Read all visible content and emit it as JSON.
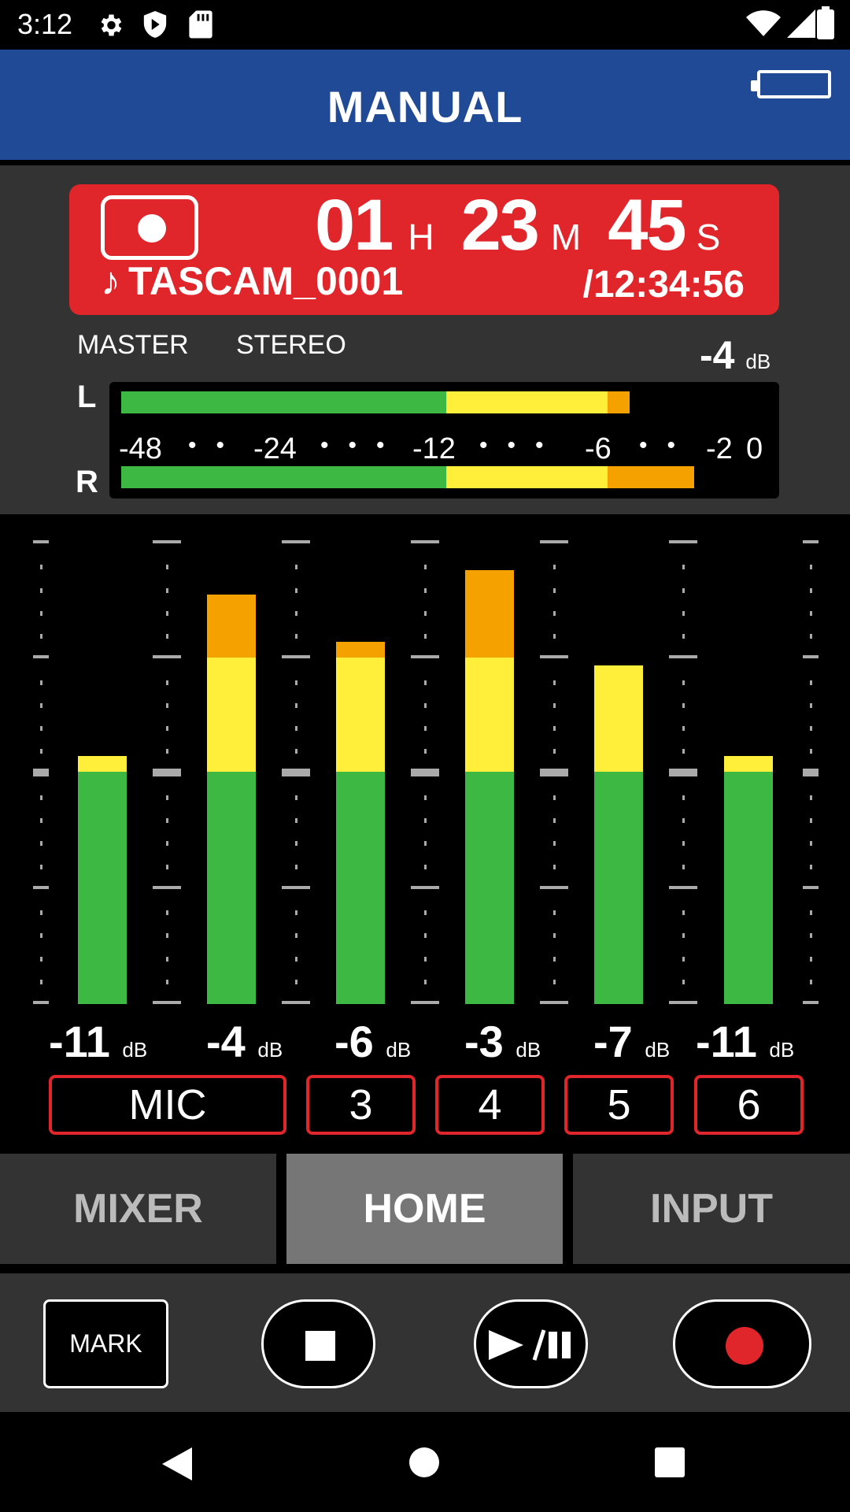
{
  "status_bar": {
    "time": "3:12"
  },
  "header": {
    "title": "MANUAL"
  },
  "recorder": {
    "hours": "01",
    "hours_unit": "H",
    "minutes": "23",
    "minutes_unit": "M",
    "seconds": "45",
    "seconds_unit": "S",
    "file_name": "TASCAM_0001",
    "total_time": "/12:34:56"
  },
  "master": {
    "label": "MASTER",
    "mode": "STEREO",
    "level_db": "-4",
    "db_unit": "dB",
    "left_label": "L",
    "right_label": "R",
    "left_level_fraction": 0.79,
    "right_level_fraction": 0.89,
    "scale_labels": [
      "-48",
      "-24",
      "-12",
      "-6",
      "-2",
      "0"
    ]
  },
  "channels": [
    {
      "label": "MIC",
      "db": "-11",
      "level_fraction": 0.52
    },
    {
      "label": "MIC",
      "db": "-4",
      "level_fraction": 0.86
    },
    {
      "label": "3",
      "db": "-6",
      "level_fraction": 0.76
    },
    {
      "label": "4",
      "db": "-3",
      "level_fraction": 0.91
    },
    {
      "label": "5",
      "db": "-7",
      "level_fraction": 0.71
    },
    {
      "label": "6",
      "db": "-11",
      "level_fraction": 0.52
    }
  ],
  "db_unit": "dB",
  "tabs": {
    "mixer": "MIXER",
    "home": "HOME",
    "input": "INPUT"
  },
  "transport": {
    "mark_label": "MARK"
  },
  "colors": {
    "header": "#214a96",
    "record_red": "#e0252b",
    "meter_green": "#3db843",
    "meter_yellow": "#ffee3a",
    "meter_orange": "#f5a100"
  }
}
